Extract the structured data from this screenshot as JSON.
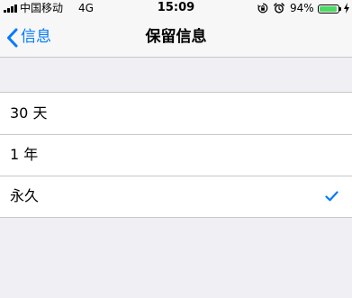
{
  "status_bar": {
    "carrier": "中国移动",
    "network": "4G",
    "time": "15:09",
    "battery_percent": "94%",
    "battery_level": 0.94,
    "icons": [
      "signal-bars-icon",
      "orientation-lock-icon",
      "alarm-icon",
      "battery-icon",
      "charging-bolt-icon"
    ]
  },
  "nav": {
    "back_label": "信息",
    "back_icon": "chevron-left-icon",
    "title": "保留信息"
  },
  "options": [
    {
      "label": "30 天",
      "selected": false
    },
    {
      "label": "1 年",
      "selected": false
    },
    {
      "label": "永久",
      "selected": true
    }
  ],
  "colors": {
    "accent": "#007aff",
    "background": "#efeff4",
    "battery": "#4cd964",
    "separator": "#c8c7cc"
  }
}
